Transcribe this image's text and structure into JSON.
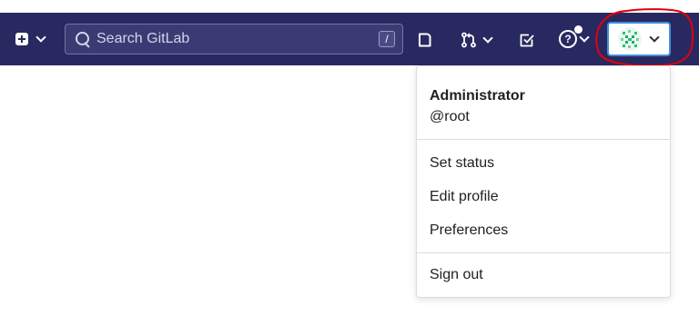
{
  "search": {
    "placeholder": "Search GitLab",
    "shortcut": "/"
  },
  "user_menu": {
    "name": "Administrator",
    "username": "@root",
    "items": [
      {
        "label": "Set status"
      },
      {
        "label": "Edit profile"
      },
      {
        "label": "Preferences"
      }
    ],
    "sign_out": "Sign out"
  },
  "icons": {
    "create": "plus-square-icon",
    "search": "search-icon",
    "issues": "issues-icon",
    "merge_requests": "merge-request-icon",
    "todos": "todo-check-icon",
    "help": "question-icon"
  },
  "colors": {
    "navbar": "#292961",
    "focus_border": "#428fdc",
    "annotation": "#e3000b"
  }
}
